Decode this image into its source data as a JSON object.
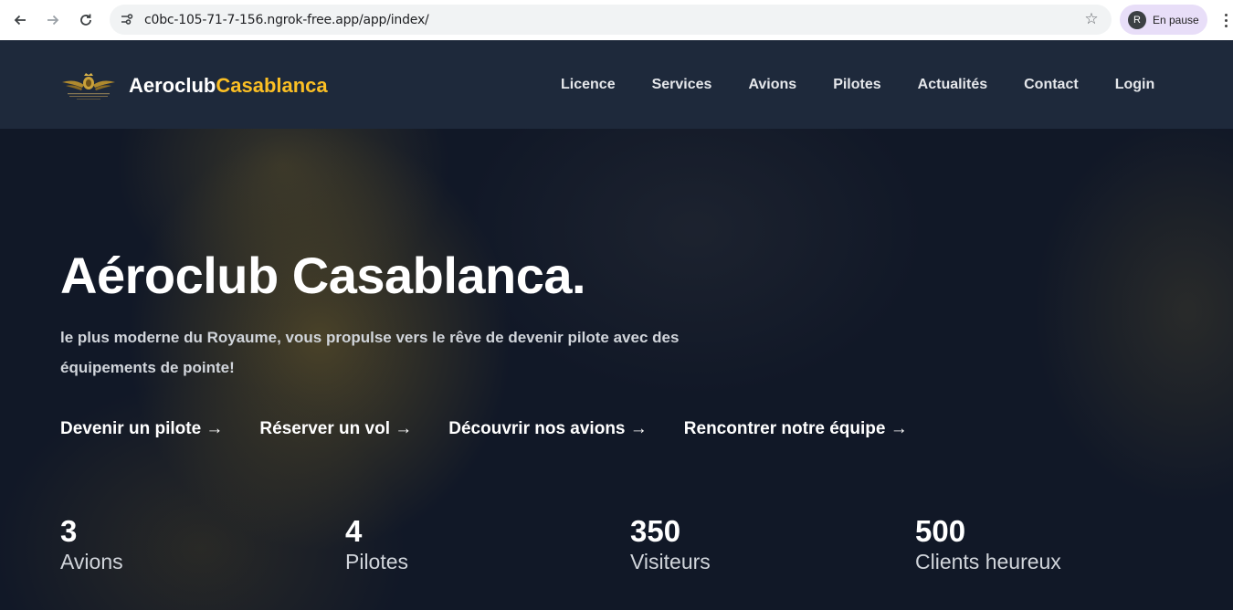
{
  "browser": {
    "url": "c0bc-105-71-7-156.ngrok-free.app/app/index/",
    "profile_initial": "R",
    "profile_status": "En pause",
    "icons": {
      "back": "arrow-left-icon",
      "forward": "arrow-right-icon",
      "reload": "reload-icon",
      "site_info": "tune-icon",
      "bookmark": "star-icon",
      "menu": "kebab-icon"
    }
  },
  "header": {
    "brand_main": "Aeroclub",
    "brand_accent": "Casablanca",
    "nav": [
      "Licence",
      "Services",
      "Avions",
      "Pilotes",
      "Actualités",
      "Contact",
      "Login"
    ]
  },
  "hero": {
    "title": "Aéroclub Casablanca.",
    "subtitle": "le plus moderne du Royaume, vous propulse vers le rêve de devenir pilote avec des équipements de pointe!",
    "ctas": [
      "Devenir un pilote →",
      "Réserver un vol →",
      "Découvrir nos avions →",
      "Rencontrer notre équipe →"
    ]
  },
  "stats": [
    {
      "value": "3",
      "label": "Avions"
    },
    {
      "value": "4",
      "label": "Pilotes"
    },
    {
      "value": "350",
      "label": "Visiteurs"
    },
    {
      "value": "500",
      "label": "Clients heureux"
    }
  ],
  "colors": {
    "accent": "#fbbf24",
    "header_bg": "#1e293b",
    "hero_bg": "#111827"
  }
}
